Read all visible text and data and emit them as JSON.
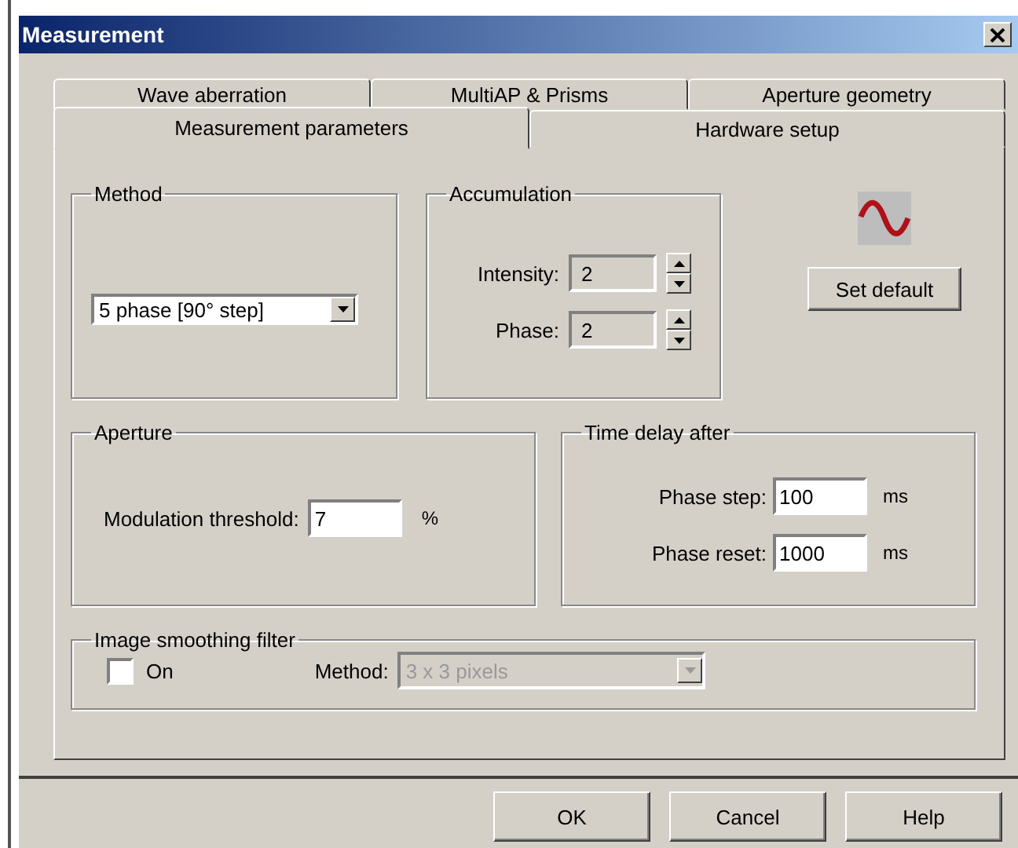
{
  "window": {
    "title": "Measurement"
  },
  "tab_rows": [
    [
      {
        "label": "Wave aberration",
        "selected": false
      },
      {
        "label": "MultiAP & Prisms",
        "selected": false
      },
      {
        "label": "Aperture geometry",
        "selected": false
      }
    ],
    [
      {
        "label": "Measurement parameters",
        "selected": true
      },
      {
        "label": "Hardware setup",
        "selected": false
      }
    ]
  ],
  "method": {
    "legend": "Method",
    "value": "5 phase [90° step]"
  },
  "accumulation": {
    "legend": "Accumulation",
    "fields": [
      {
        "label": "Intensity:",
        "value": "2"
      },
      {
        "label": "Phase:",
        "value": "2"
      }
    ]
  },
  "set_default": "Set default",
  "aperture": {
    "legend": "Aperture",
    "label": "Modulation threshold:",
    "value": "7",
    "unit": "%"
  },
  "time_delay": {
    "legend": "Time delay after",
    "fields": [
      {
        "label": "Phase step:",
        "value": "100",
        "unit": "ms"
      },
      {
        "label": "Phase reset:",
        "value": "1000",
        "unit": "ms"
      }
    ]
  },
  "smoothing": {
    "legend": "Image smoothing filter",
    "checkbox": {
      "label": "On",
      "checked": false
    },
    "method": {
      "label": "Method:",
      "value": "3 x 3 pixels",
      "disabled": true
    }
  },
  "buttons": [
    "OK",
    "Cancel",
    "Help"
  ]
}
